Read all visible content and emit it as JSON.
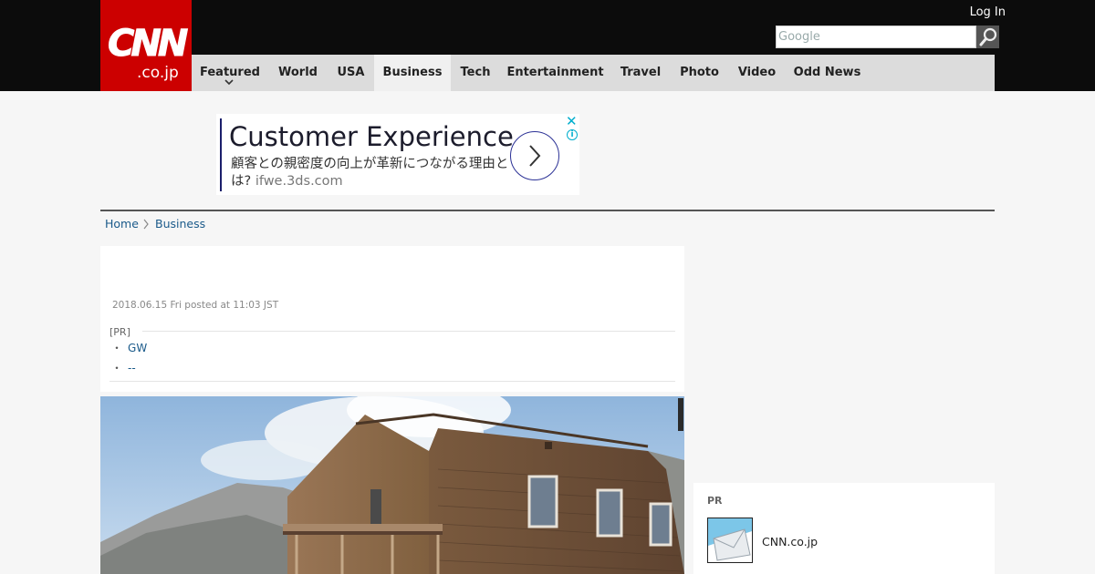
{
  "header": {
    "logo_main": "CNN",
    "logo_sub": ".co.jp",
    "login_label": "Log In",
    "search_placeholder": "Google",
    "colors": {
      "brand": "#cc0000",
      "topbar": "#0c0c0c",
      "nav": "#dcdcdc"
    }
  },
  "nav": {
    "items": [
      {
        "label": "Featured"
      },
      {
        "label": "World"
      },
      {
        "label": "USA"
      },
      {
        "label": "Business"
      },
      {
        "label": "Tech"
      },
      {
        "label": "Entertainment"
      },
      {
        "label": "Travel"
      },
      {
        "label": "Photo"
      },
      {
        "label": "Video"
      },
      {
        "label": "Odd News"
      }
    ],
    "active": "Business"
  },
  "ad": {
    "title": "Customer Experience",
    "text": "顧客との親密度の向上が革新につながる理由とは?",
    "url": "ifwe.3ds.com",
    "close_icon": "close-icon",
    "info_icon": "info-icon",
    "info_glyph": "i"
  },
  "breadcrumb": {
    "home": "Home",
    "section": "Business"
  },
  "article": {
    "date": "2018.06.15 Fri posted at 11:03 JST",
    "pr_label": "[PR]",
    "pr_links": [
      {
        "bullet": "・",
        "text": "GW"
      },
      {
        "bullet": "・",
        "text": "--"
      }
    ]
  },
  "sidebar": {
    "pr_label": "PR",
    "item_text": "CNN.co.jp"
  }
}
